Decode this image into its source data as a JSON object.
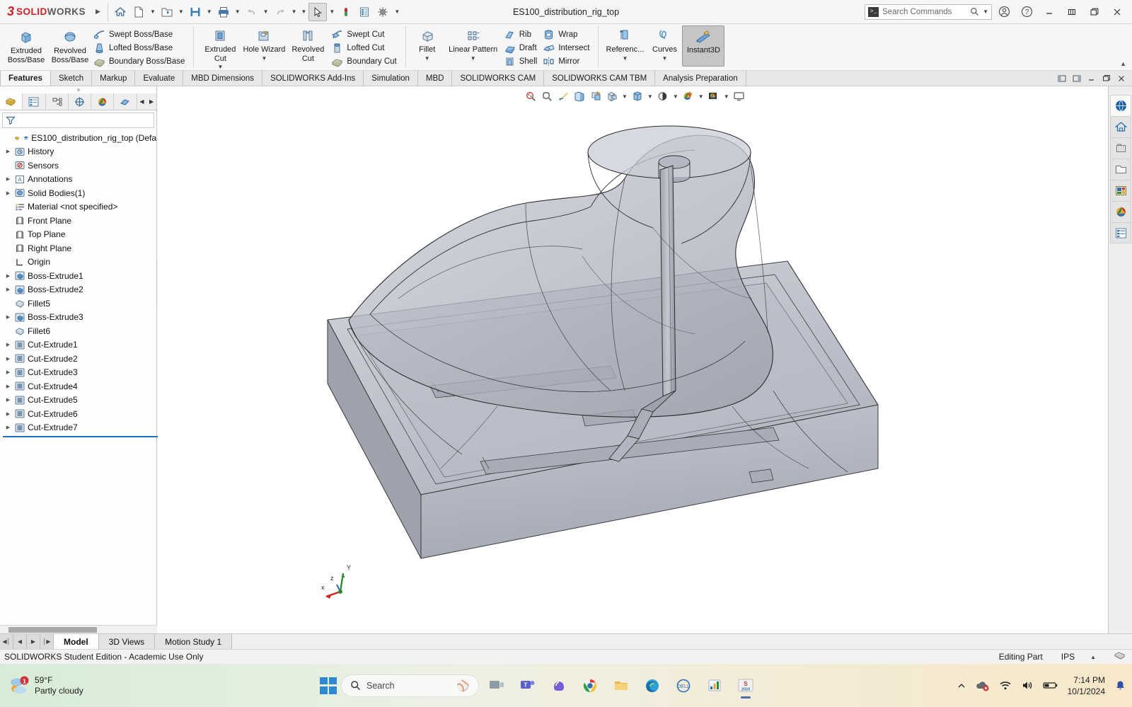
{
  "titlebar": {
    "brand_ds": "3S",
    "brand_solid": "SOLID",
    "brand_works": "WORKS",
    "document_title": "ES100_distribution_rig_top",
    "search_placeholder": "Search Commands",
    "quick_access": [
      {
        "name": "home-icon",
        "label": "Home"
      },
      {
        "name": "new-document-icon",
        "label": "New"
      },
      {
        "name": "open-folder-icon",
        "label": "Open"
      },
      {
        "name": "save-icon",
        "label": "Save"
      },
      {
        "name": "print-icon",
        "label": "Print"
      },
      {
        "name": "undo-icon",
        "label": "Undo"
      },
      {
        "name": "redo-icon",
        "label": "Redo"
      },
      {
        "name": "select-cursor-icon",
        "label": "Select"
      },
      {
        "name": "rebuild-icon",
        "label": "Rebuild"
      },
      {
        "name": "file-properties-icon",
        "label": "File Properties"
      },
      {
        "name": "options-gear-icon",
        "label": "Options"
      }
    ],
    "window_controls": {
      "account": "account-icon",
      "help": "help-icon",
      "minimize": "minimize-icon",
      "restore": "restore-icon",
      "maximize": "maximize-icon",
      "close": "close-icon"
    }
  },
  "ribbon": {
    "groups": [
      {
        "big": [
          {
            "label": "Extruded\nBoss/Base",
            "icon": "extruded-boss-icon"
          },
          {
            "label": "Revolved\nBoss/Base",
            "icon": "revolved-boss-icon"
          }
        ],
        "small": [
          {
            "label": "Swept Boss/Base",
            "icon": "swept-boss-icon"
          },
          {
            "label": "Lofted Boss/Base",
            "icon": "lofted-boss-icon"
          },
          {
            "label": "Boundary Boss/Base",
            "icon": "boundary-boss-icon"
          }
        ]
      },
      {
        "big": [
          {
            "label": "Extruded\nCut",
            "icon": "extruded-cut-icon",
            "caret": true
          },
          {
            "label": "Hole Wizard",
            "icon": "hole-wizard-icon",
            "caret": true
          },
          {
            "label": "Revolved\nCut",
            "icon": "revolved-cut-icon"
          }
        ],
        "small": [
          {
            "label": "Swept Cut",
            "icon": "swept-cut-icon"
          },
          {
            "label": "Lofted Cut",
            "icon": "lofted-cut-icon"
          },
          {
            "label": "Boundary Cut",
            "icon": "boundary-cut-icon"
          }
        ]
      },
      {
        "big": [
          {
            "label": "Fillet",
            "icon": "fillet-icon",
            "caret": true
          },
          {
            "label": "Linear Pattern",
            "icon": "linear-pattern-icon",
            "caret": true
          }
        ],
        "small": [
          {
            "label": "Rib",
            "icon": "rib-icon"
          },
          {
            "label": "Draft",
            "icon": "draft-icon"
          },
          {
            "label": "Shell",
            "icon": "shell-icon"
          }
        ],
        "small2": [
          {
            "label": "Wrap",
            "icon": "wrap-icon"
          },
          {
            "label": "Intersect",
            "icon": "intersect-icon"
          },
          {
            "label": "Mirror",
            "icon": "mirror-icon"
          }
        ]
      },
      {
        "big": [
          {
            "label": "Referenc...",
            "icon": "reference-geometry-icon",
            "caret": true
          },
          {
            "label": "Curves",
            "icon": "curves-icon",
            "caret": true
          },
          {
            "label": "Instant3D",
            "icon": "instant3d-icon",
            "active": true
          }
        ]
      }
    ],
    "collapse_caret": "▲"
  },
  "command_tabs": {
    "active": "Features",
    "items": [
      "Features",
      "Sketch",
      "Markup",
      "Evaluate",
      "MBD Dimensions",
      "SOLIDWORKS Add-Ins",
      "Simulation",
      "MBD",
      "SOLIDWORKS CAM",
      "SOLIDWORKS CAM TBM",
      "Analysis Preparation"
    ],
    "right_controls": [
      "pin-left-icon",
      "pin-right-icon",
      "minimize-icon",
      "restore-icon",
      "close-icon"
    ]
  },
  "feature_manager": {
    "tabs": [
      {
        "name": "feature-manager-tab",
        "label": "FeatureManager Design Tree",
        "active": true
      },
      {
        "name": "property-manager-tab",
        "label": "PropertyManager"
      },
      {
        "name": "configuration-manager-tab",
        "label": "ConfigurationManager"
      },
      {
        "name": "dimxpert-manager-tab",
        "label": "DimXpertManager"
      },
      {
        "name": "display-manager-tab",
        "label": "DisplayManager"
      },
      {
        "name": "cam-manager-tab",
        "label": "CAM FeatureManager"
      }
    ],
    "filter_placeholder": "",
    "root": {
      "label": "ES100_distribution_rig_top (Defa",
      "icon": "part-document-icon"
    },
    "items": [
      {
        "label": "History",
        "icon": "history-icon",
        "expandable": true,
        "indent": 1
      },
      {
        "label": "Sensors",
        "icon": "sensors-icon",
        "expandable": false,
        "indent": 1
      },
      {
        "label": "Annotations",
        "icon": "annotations-icon",
        "expandable": true,
        "indent": 1
      },
      {
        "label": "Solid Bodies(1)",
        "icon": "solid-bodies-icon",
        "expandable": true,
        "indent": 1
      },
      {
        "label": "Material <not specified>",
        "icon": "material-icon",
        "expandable": false,
        "indent": 1
      },
      {
        "label": "Front Plane",
        "icon": "plane-icon",
        "expandable": false,
        "indent": 1
      },
      {
        "label": "Top Plane",
        "icon": "plane-icon",
        "expandable": false,
        "indent": 1
      },
      {
        "label": "Right Plane",
        "icon": "plane-icon",
        "expandable": false,
        "indent": 1
      },
      {
        "label": "Origin",
        "icon": "origin-icon",
        "expandable": false,
        "indent": 1
      },
      {
        "label": "Boss-Extrude1",
        "icon": "boss-extrude-icon",
        "expandable": true,
        "indent": 1
      },
      {
        "label": "Boss-Extrude2",
        "icon": "boss-extrude-icon",
        "expandable": true,
        "indent": 1
      },
      {
        "label": "Fillet5",
        "icon": "fillet-feature-icon",
        "expandable": false,
        "indent": 1
      },
      {
        "label": "Boss-Extrude3",
        "icon": "boss-extrude-icon",
        "expandable": true,
        "indent": 1
      },
      {
        "label": "Fillet6",
        "icon": "fillet-feature-icon",
        "expandable": false,
        "indent": 1
      },
      {
        "label": "Cut-Extrude1",
        "icon": "cut-extrude-icon",
        "expandable": true,
        "indent": 1
      },
      {
        "label": "Cut-Extrude2",
        "icon": "cut-extrude-icon",
        "expandable": true,
        "indent": 1
      },
      {
        "label": "Cut-Extrude3",
        "icon": "cut-extrude-icon",
        "expandable": true,
        "indent": 1
      },
      {
        "label": "Cut-Extrude4",
        "icon": "cut-extrude-icon",
        "expandable": true,
        "indent": 1
      },
      {
        "label": "Cut-Extrude5",
        "icon": "cut-extrude-icon",
        "expandable": true,
        "indent": 1
      },
      {
        "label": "Cut-Extrude6",
        "icon": "cut-extrude-icon",
        "expandable": true,
        "indent": 1
      },
      {
        "label": "Cut-Extrude7",
        "icon": "cut-extrude-icon",
        "expandable": true,
        "indent": 1
      }
    ]
  },
  "view_toolbar": {
    "buttons": [
      {
        "name": "zoom-to-fit-icon",
        "label": "Zoom to Fit"
      },
      {
        "name": "zoom-to-area-icon",
        "label": "Zoom to Area"
      },
      {
        "name": "previous-view-icon",
        "label": "Previous View"
      },
      {
        "name": "section-view-icon",
        "label": "Section View"
      },
      {
        "name": "view-orientation-icon",
        "label": "View Orientation"
      },
      {
        "name": "display-style-icon",
        "label": "Display Style",
        "caret": true
      },
      {
        "name": "hide-show-items-icon",
        "label": "Hide/Show Items",
        "caret": true
      },
      {
        "name": "edit-appearance-icon",
        "label": "Edit Appearance",
        "caret": true
      },
      {
        "name": "apply-scene-icon",
        "label": "Apply Scene",
        "caret": true
      },
      {
        "name": "view-settings-icon",
        "label": "View Settings",
        "caret": true
      },
      {
        "name": "viewport-icon",
        "label": "Viewport"
      }
    ]
  },
  "right_dock": {
    "buttons": [
      {
        "name": "solidworks-resources-icon",
        "label": "SOLIDWORKS Resources",
        "active": true
      },
      {
        "name": "design-library-icon",
        "label": "Design Library"
      },
      {
        "name": "file-explorer-icon",
        "label": "File Explorer"
      },
      {
        "name": "view-palette-icon",
        "label": "View Palette"
      },
      {
        "name": "appearances-scenes-icon",
        "label": "Appearances, Scenes and Decals"
      },
      {
        "name": "custom-properties-icon",
        "label": "Custom Properties"
      }
    ]
  },
  "triad": {
    "x_label": "x",
    "y_label": "Y",
    "z_label": "z"
  },
  "bottom_tabs": {
    "active": "Model",
    "items": [
      "Model",
      "3D Views",
      "Motion Study 1"
    ],
    "nav": [
      "first-tab-icon",
      "previous-tab-icon",
      "next-tab-icon",
      "last-tab-icon"
    ]
  },
  "status_bar": {
    "license_text": "SOLIDWORKS Student Edition - Academic Use Only",
    "editing_state": "Editing Part",
    "units": "IPS",
    "units_caret": "▲",
    "overlay_icon": "overlay-icon"
  },
  "taskbar": {
    "weather": {
      "temperature": "59°F",
      "condition": "Partly cloudy",
      "badge": "1"
    },
    "search_placeholder": "Search",
    "apps": [
      {
        "name": "task-view-icon",
        "label": "Task View"
      },
      {
        "name": "microsoft-teams-icon",
        "label": "Microsoft Teams"
      },
      {
        "name": "copilot-icon",
        "label": "Copilot"
      },
      {
        "name": "google-chrome-icon",
        "label": "Google Chrome"
      },
      {
        "name": "file-explorer-taskbar-icon",
        "label": "File Explorer"
      },
      {
        "name": "microsoft-edge-icon",
        "label": "Microsoft Edge"
      },
      {
        "name": "dell-icon",
        "label": "Dell"
      },
      {
        "name": "excel-icon",
        "label": "Excel"
      },
      {
        "name": "solidworks-taskbar-icon",
        "label": "SOLIDWORKS",
        "running": true
      }
    ],
    "tray": {
      "chevron": "show-hidden-icons",
      "onedrive": "onedrive-error-icon",
      "wifi": "wifi-icon",
      "volume": "volume-icon",
      "battery": "battery-icon",
      "time": "7:14 PM",
      "date": "10/1/2024",
      "notification": "notification-bell-icon"
    }
  },
  "colors": {
    "brand_red": "#cf1f26",
    "accent_blue": "#1a6fc4",
    "model_body": "#b9bcc6",
    "ribbon_bg": "#f6f6f6",
    "panel_bg": "#fdfdfd"
  }
}
